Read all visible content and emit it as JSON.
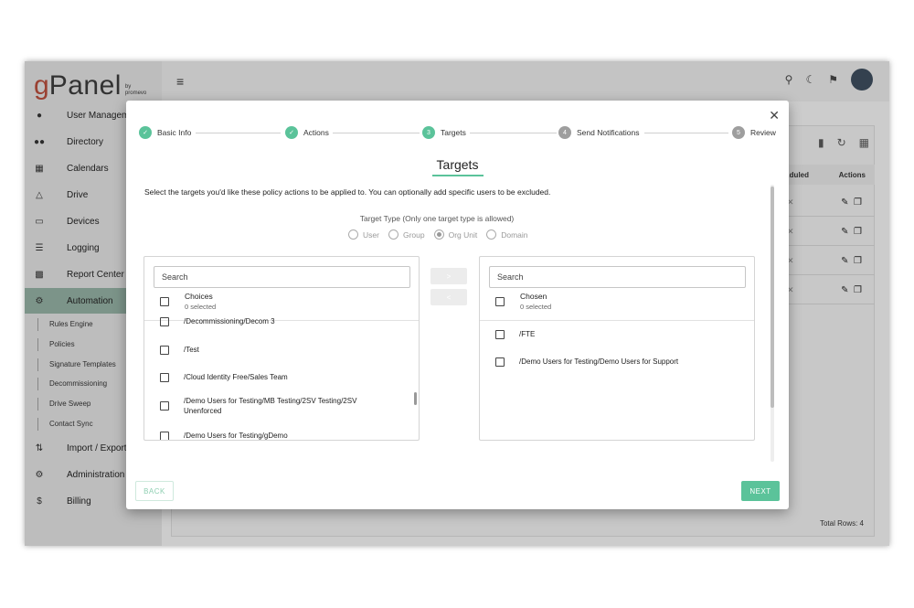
{
  "app": {
    "logo_g": "g",
    "logo_rest": "Panel",
    "logo_by": "by",
    "logo_brand": "promevo",
    "sidebar": [
      {
        "label": "User Management",
        "icon": "person-icon"
      },
      {
        "label": "Directory",
        "icon": "group-icon"
      },
      {
        "label": "Calendars",
        "icon": "calendar-icon"
      },
      {
        "label": "Drive",
        "icon": "drive-icon"
      },
      {
        "label": "Devices",
        "icon": "devices-icon"
      },
      {
        "label": "Logging",
        "icon": "list-icon"
      },
      {
        "label": "Report Center",
        "icon": "report-icon"
      },
      {
        "label": "Automation",
        "icon": "automation-icon",
        "active": true
      },
      {
        "label": "Import / Export",
        "icon": "import-export-icon"
      },
      {
        "label": "Administration",
        "icon": "admin-icon"
      },
      {
        "label": "Billing",
        "icon": "dollar-icon"
      }
    ],
    "automation_sub": [
      "Rules Engine",
      "Policies",
      "Signature Templates",
      "Decommissioning",
      "Drive Sweep",
      "Contact Sync"
    ],
    "table": {
      "headers": [
        "...duled",
        "Actions"
      ],
      "rows": 4
    },
    "total_rows": "Total Rows: 4"
  },
  "modal": {
    "steps": [
      {
        "label": "Basic Info",
        "state": "done"
      },
      {
        "label": "Actions",
        "state": "done"
      },
      {
        "label": "Targets",
        "number": "3",
        "state": "active"
      },
      {
        "label": "Send Notifications",
        "number": "4",
        "state": "pending"
      },
      {
        "label": "Review",
        "number": "5",
        "state": "pending"
      }
    ],
    "title": "Targets",
    "description": "Select the targets you'd like these policy actions to be applied to. You can optionally add specific users to be excluded.",
    "target_type_label": "Target Type (Only one target type is allowed)",
    "target_types": [
      {
        "label": "User",
        "selected": false
      },
      {
        "label": "Group",
        "selected": false
      },
      {
        "label": "Org Unit",
        "selected": true
      },
      {
        "label": "Domain",
        "selected": false
      }
    ],
    "left_panel": {
      "search_placeholder": "Search",
      "header": "Choices",
      "count": "0 selected",
      "items": [
        "/Decommissioning/Decom 3",
        "/Test",
        "/Cloud Identity Free/Sales Team",
        "/Demo Users for Testing/MB Testing/2SV Testing/2SV Unenforced",
        "/Demo Users for Testing/gDemo"
      ]
    },
    "right_panel": {
      "search_placeholder": "Search",
      "header": "Chosen",
      "count": "0 selected",
      "items": [
        "/FTE",
        "/Demo Users for Testing/Demo Users for Support"
      ]
    },
    "move_right": ">",
    "move_left": "<",
    "back_label": "BACK",
    "next_label": "NEXT",
    "accent": "#5bc39a"
  }
}
